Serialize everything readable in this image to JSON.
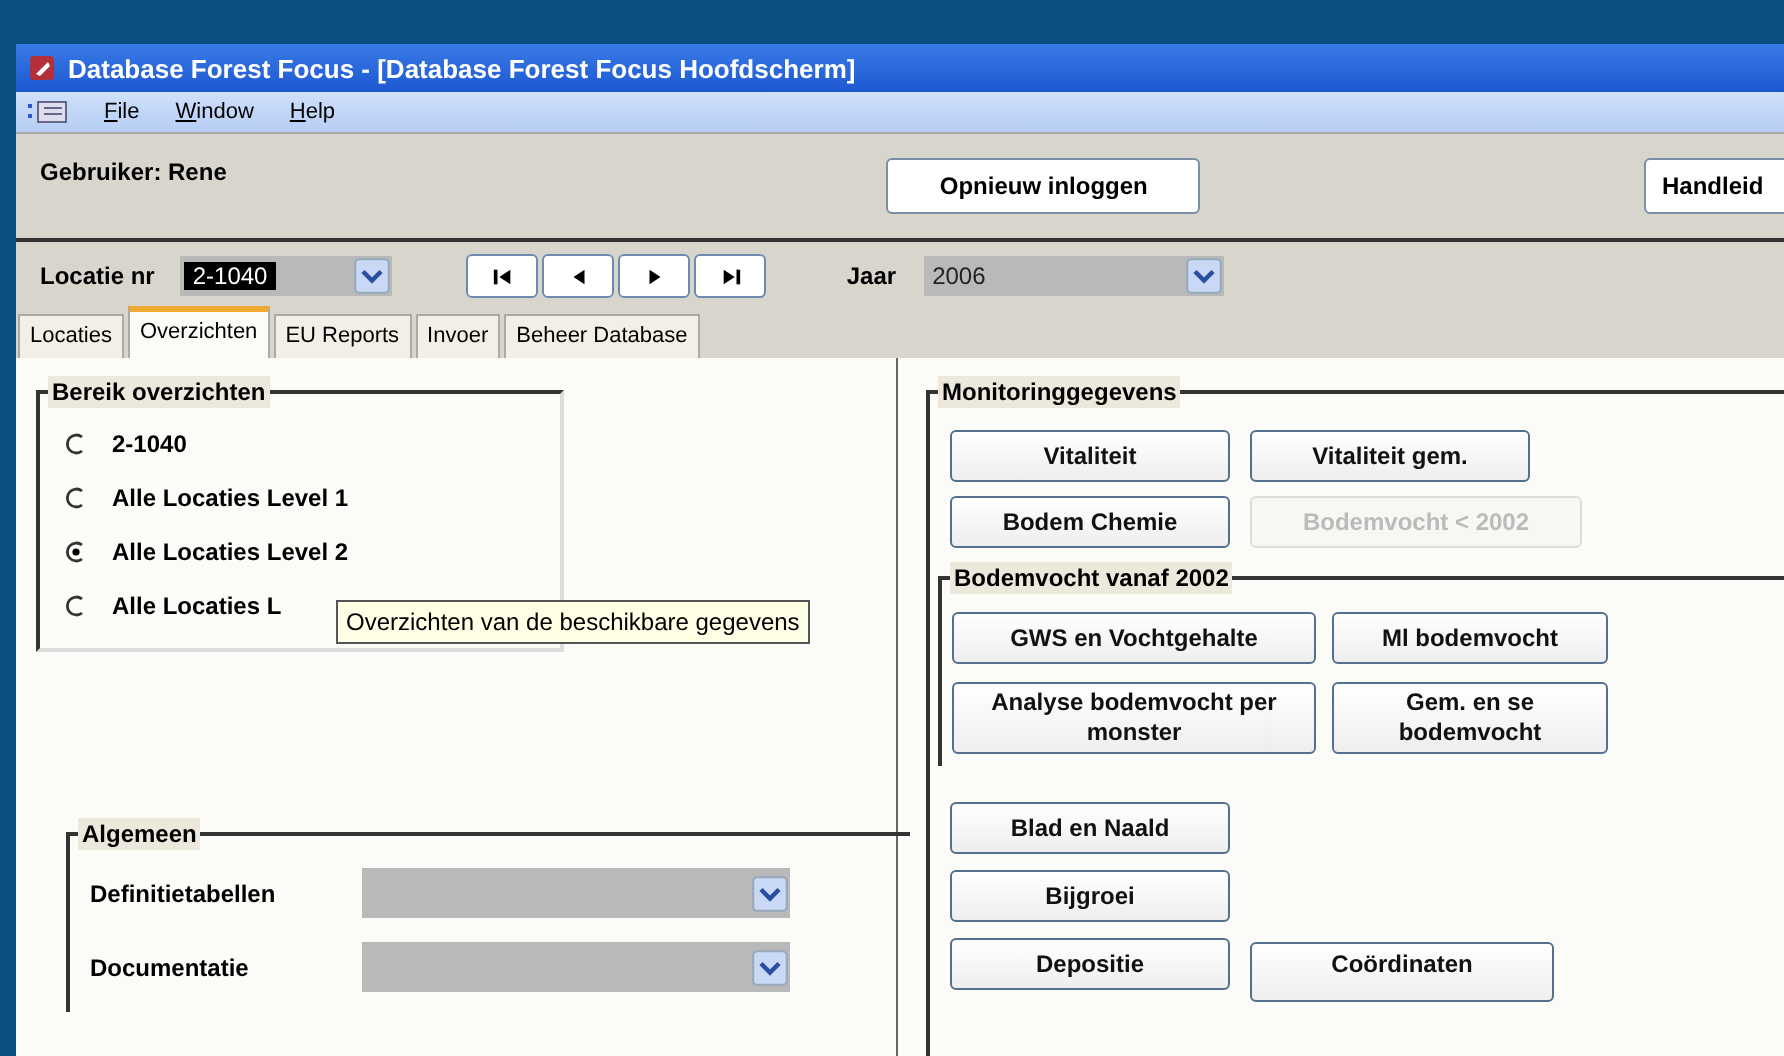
{
  "window": {
    "title": "Database Forest Focus - [Database Forest Focus Hoofdscherm]"
  },
  "menu": [
    "File",
    "Window",
    "Help"
  ],
  "user_label": "Gebruiker: Rene",
  "header_buttons": [
    "Opnieuw inloggen",
    "Handleid"
  ],
  "location": {
    "label": "Locatie nr",
    "value": "2-1040"
  },
  "nav_buttons": [
    {
      "kind": "first"
    },
    {
      "kind": "prev"
    },
    {
      "kind": "next"
    },
    {
      "kind": "last"
    }
  ],
  "year": {
    "label": "Jaar",
    "value": "2006"
  },
  "tabs": [
    {
      "label": "Locaties",
      "selected": false
    },
    {
      "label": "Overzichten",
      "selected": true
    },
    {
      "label": "EU Reports",
      "selected": false
    },
    {
      "label": "Invoer",
      "selected": false
    },
    {
      "label": "Beheer Database",
      "selected": false
    }
  ],
  "range": {
    "title": "Bereik overzichten",
    "options": [
      {
        "label": "2-1040",
        "selected": false
      },
      {
        "label": "Alle Locaties Level 1",
        "selected": false
      },
      {
        "label": "Alle Locaties Level 2",
        "selected": true
      },
      {
        "label": "Alle Locaties L",
        "selected": false
      }
    ]
  },
  "tooltip": "Overzichten van de beschikbare gegevens",
  "general": {
    "title": "Algemeen",
    "fields": [
      {
        "label": "Definitietabellen"
      },
      {
        "label": "Documentatie"
      }
    ]
  },
  "monitoring": {
    "title": "Monitoringgegevens",
    "buttons": [
      {
        "label": "Vitaliteit",
        "disabled": false
      },
      {
        "label": "Vitaliteit gem.",
        "disabled": false
      },
      {
        "label": "Bodem Chemie",
        "disabled": false
      },
      {
        "label": "Bodemvocht < 2002",
        "disabled": true
      }
    ],
    "subgroup": {
      "title": "Bodemvocht vanaf 2002",
      "buttons": [
        {
          "label": "GWS en Vochtgehalte",
          "disabled": false
        },
        {
          "label": "Ml bodemvocht",
          "disabled": false
        },
        {
          "label": "Analyse bodemvocht per monster",
          "disabled": false
        },
        {
          "label": "Gem. en se bodemvocht",
          "disabled": false
        }
      ]
    },
    "more_buttons": [
      {
        "label": "Blad en Naald",
        "disabled": false
      },
      {
        "label": "Bijgroei",
        "disabled": false
      },
      {
        "label": "Depositie",
        "disabled": false
      },
      {
        "label": "Coördinaten",
        "disabled": false
      }
    ]
  }
}
